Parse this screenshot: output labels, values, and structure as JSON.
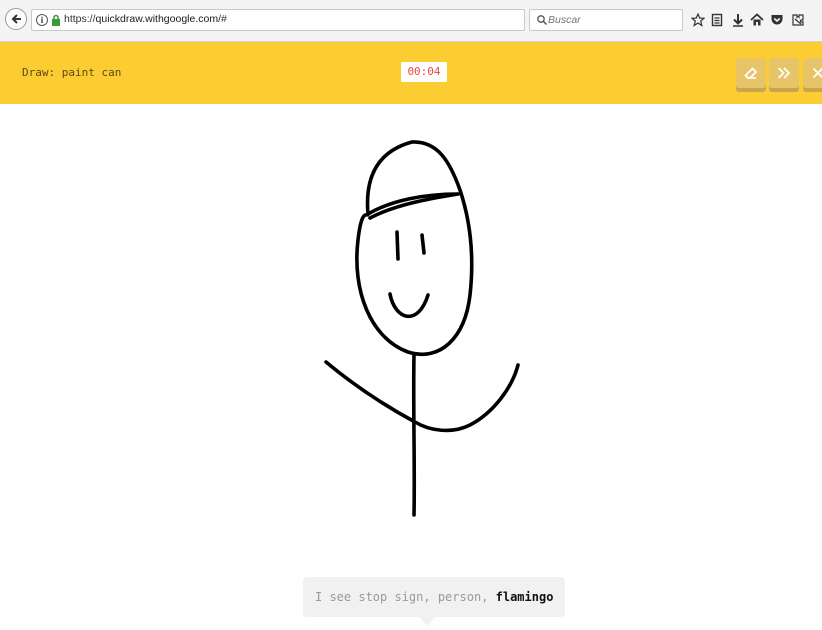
{
  "browser": {
    "url_protocol": "https://",
    "url_host": "quickdraw.withgoogle.com",
    "url_path": "/#",
    "search_placeholder": "Buscar",
    "toolbar_icons": [
      "bookmark-star-icon",
      "reading-list-icon",
      "download-icon",
      "home-icon",
      "pocket-icon",
      "extension-icon"
    ]
  },
  "header": {
    "prompt_prefix": "Draw:",
    "prompt_subject": "paint can",
    "timer": "00:04",
    "buttons": [
      "eraser-icon",
      "skip-icon",
      "close-icon"
    ],
    "colors": {
      "header_bg": "#fccc33",
      "timer_text": "#e74c3c",
      "button_bg": "#e8c469"
    }
  },
  "guess": {
    "prefix": "I see stop sign, person,",
    "current_guess": "flamingo"
  }
}
